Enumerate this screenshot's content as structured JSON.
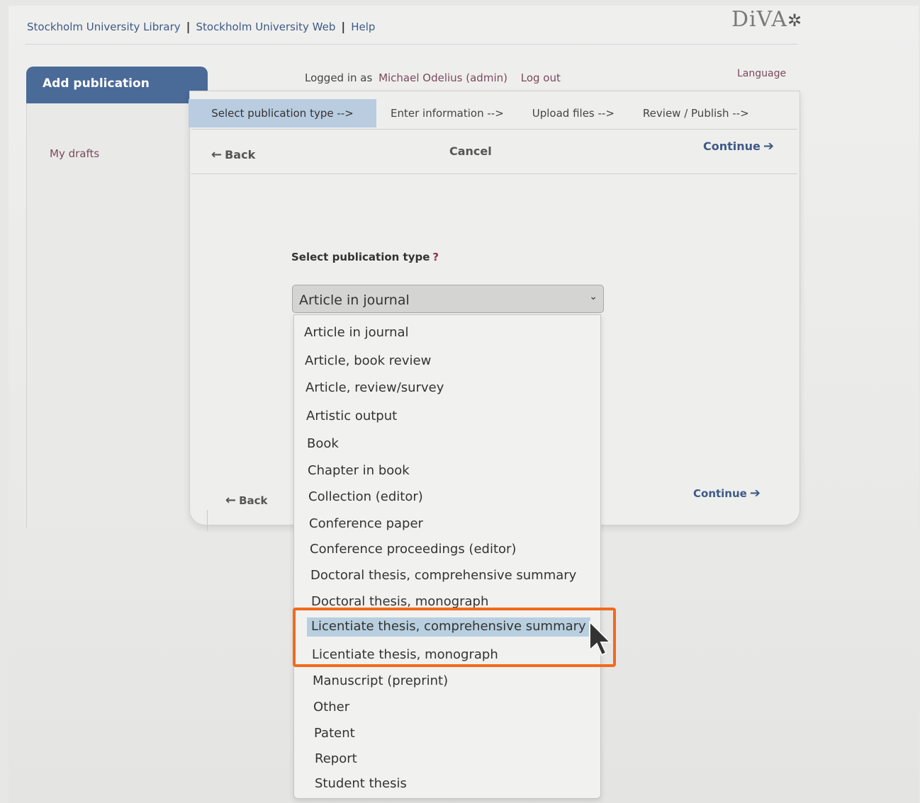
{
  "top_links": [
    "Stockholm University Library",
    "Stockholm University Web",
    "Help"
  ],
  "top_link_separator": "|",
  "logo": {
    "text": "DiVA",
    "mark": "✲"
  },
  "tab": {
    "label": "Add publication"
  },
  "login": {
    "prefix": "Logged in as",
    "user": "Michael Odelius (admin)",
    "logout": "Log out"
  },
  "language_label": "Language",
  "sidebar": {
    "my_drafts": "My drafts"
  },
  "steps": [
    "Select publication type -->",
    "Enter information -->",
    "Upload files -->",
    "Review / Publish -->"
  ],
  "toolbar": {
    "back": "Back",
    "cancel": "Cancel",
    "continue": "Continue"
  },
  "form": {
    "label": "Select publication type",
    "help": "?",
    "selected": "Article in journal",
    "options": [
      "Article in journal",
      "Article, book review",
      "Article, review/survey",
      "Artistic output",
      "Book",
      "Chapter in book",
      "Collection (editor)",
      "Conference paper",
      "Conference proceedings (editor)",
      "Doctoral thesis, comprehensive summary",
      "Doctoral thesis, monograph",
      "Licentiate thesis, comprehensive summary",
      "Licentiate thesis, monograph",
      "Manuscript (preprint)",
      "Other",
      "Patent",
      "Report",
      "Student thesis"
    ],
    "hovered_option": "Licentiate thesis, comprehensive summary"
  },
  "bottom": {
    "back": "Back",
    "continue": "Continue"
  },
  "colors": {
    "accent": "#4a6a98",
    "link": "#3e5a86",
    "highlight_box": "#f26a1b",
    "option_hover": "#b8cfdf"
  }
}
